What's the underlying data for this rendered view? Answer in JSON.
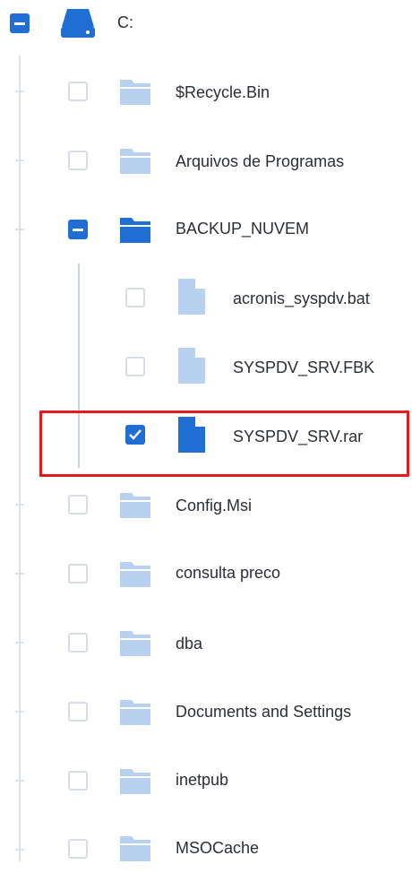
{
  "tree": {
    "root": {
      "label": "C:",
      "icon": "drive-icon",
      "state": "partial"
    },
    "items": [
      {
        "label": "$Recycle.Bin",
        "icon": "folder-icon",
        "state": "unchecked"
      },
      {
        "label": "Arquivos de Programas",
        "icon": "folder-icon",
        "state": "unchecked"
      },
      {
        "label": "BACKUP_NUVEM",
        "icon": "folder-icon",
        "state": "partial",
        "expanded": true,
        "children": [
          {
            "label": "acronis_syspdv.bat",
            "icon": "file-icon",
            "state": "unchecked"
          },
          {
            "label": "SYSPDV_SRV.FBK",
            "icon": "file-icon",
            "state": "unchecked"
          },
          {
            "label": "SYSPDV_SRV.rar",
            "icon": "file-icon",
            "state": "checked",
            "highlighted": true
          }
        ]
      },
      {
        "label": "Config.Msi",
        "icon": "folder-icon",
        "state": "unchecked"
      },
      {
        "label": "consulta preco",
        "icon": "folder-icon",
        "state": "unchecked"
      },
      {
        "label": "dba",
        "icon": "folder-icon",
        "state": "unchecked"
      },
      {
        "label": "Documents and Settings",
        "icon": "folder-icon",
        "state": "unchecked"
      },
      {
        "label": "inetpub",
        "icon": "folder-icon",
        "state": "unchecked"
      },
      {
        "label": "MSOCache",
        "icon": "folder-icon",
        "state": "unchecked"
      }
    ]
  },
  "colors": {
    "accent": "#1f6ed4",
    "icon_light": "#b9d1f0",
    "highlight_border": "#e61a1a",
    "tree_line": "#dde3ea"
  }
}
